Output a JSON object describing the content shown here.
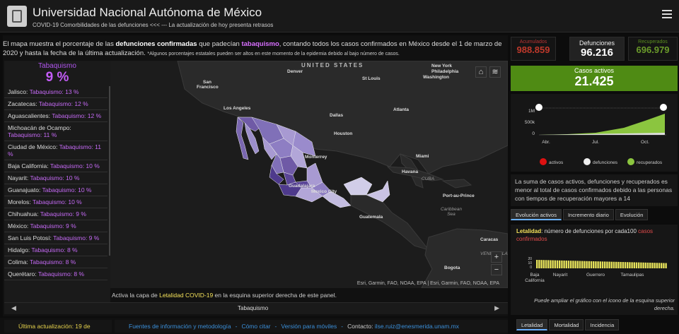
{
  "header": {
    "title": "Universidad Nacional Autónoma de México",
    "subtitle": "COVID-19 Comorbilidades de las defunciones <<< --- La actualización de hoy presenta retrasos"
  },
  "intro": {
    "p1": "El mapa muestra el porcentaje de las ",
    "b1": "defunciones confirmadas",
    "p2": " que padecían ",
    "hl": "tabaquismo",
    "p3": ", contando todos los casos confirmados en México desde el 1 de marzo de 2020 y hasta la fecha de la última actualización. ",
    "note": "*Algunos porcentajes estatales pueden ser altos en este momento de la epidemia debido al bajo número de casos."
  },
  "list": {
    "header_label": "Tabaquismo",
    "header_value": "9 %",
    "items": [
      {
        "state": "Jalisco:",
        "value": "Tabaquismo: 13 %"
      },
      {
        "state": "Zacatecas:",
        "value": "Tabaquismo: 12 %"
      },
      {
        "state": "Aguascalientes:",
        "value": "Tabaquismo: 12 %"
      },
      {
        "state": "Michoacán de Ocampo:",
        "value": "Tabaquismo: 11 %"
      },
      {
        "state": "Ciudad de México:",
        "value": "Tabaquismo: 11 %"
      },
      {
        "state": "Baja California:",
        "value": "Tabaquismo: 10 %"
      },
      {
        "state": "Nayarit:",
        "value": "Tabaquismo: 10 %"
      },
      {
        "state": "Guanajuato:",
        "value": "Tabaquismo: 10 %"
      },
      {
        "state": "Morelos:",
        "value": "Tabaquismo: 10 %"
      },
      {
        "state": "Chihuahua:",
        "value": "Tabaquismo: 9 %"
      },
      {
        "state": "México:",
        "value": "Tabaquismo: 9 %"
      },
      {
        "state": "San Luis Potosí:",
        "value": "Tabaquismo: 9 %"
      },
      {
        "state": "Hidalgo:",
        "value": "Tabaquismo: 8 %"
      },
      {
        "state": "Colima:",
        "value": "Tabaquismo: 8 %"
      },
      {
        "state": "Querétaro:",
        "value": "Tabaquismo: 8 %"
      }
    ]
  },
  "map": {
    "labels": {
      "united_states": "UNITED STATES",
      "new_york": "New York",
      "philadelphia": "Philadelphia",
      "washington": "Washington",
      "denver": "Denver",
      "st_louis": "St Louis",
      "san_francisco": "San Francisco",
      "los_angeles": "Los Angeles",
      "dallas": "Dallas",
      "atlanta": "Atlanta",
      "houston": "Houston",
      "miami": "Miami",
      "havana": "Havana",
      "cuba": "CUBA",
      "port_au_prince": "Port-au-Prince",
      "caribbean_sea": "Caribbean Sea",
      "monterrey": "Monterrey",
      "guadalajara": "Guadalajara",
      "mexico_city": "Mexico City",
      "guatemala": "Guatemala",
      "caracas": "Caracas",
      "bogota": "Bogota",
      "venezuela": "VENEZUELA"
    },
    "attribution": "Esri, Garmin, FAO, NOAA, EPA | Esri, Garmin, FAO, NOAA, EPA",
    "zoom_in": "+",
    "zoom_out": "−",
    "activa_prefix": "Activa la capa de ",
    "activa_hl": "Letalidad COVID-19",
    "activa_suffix": " en la esquina superior derecha de este panel.",
    "bottom_label": "Tabaquismo"
  },
  "footer": {
    "update": "Última actualización: 19 de",
    "link1": "Fuentes de información y metodología",
    "link2": "Cómo citar",
    "link3": "Versión para móviles",
    "contact_label": "Contacto: ",
    "contact_email": "ilse.ruiz@enesmerida.unam.mx"
  },
  "stats": {
    "acumulados_label": "Acumulados",
    "acumulados_value": "988.859",
    "defunciones_label": "Defunciones",
    "defunciones_value": "96.216",
    "recuperados_label": "Recuperados",
    "recuperados_value": "696.979",
    "activos_label": "Casos activos",
    "activos_value": "21.425"
  },
  "trend_chart": {
    "y_ticks": [
      "1M",
      "500k",
      "0"
    ],
    "x_ticks": [
      "Abr.",
      "Jul.",
      "Oct."
    ],
    "legend": [
      "activos",
      "defunciones",
      "recuperados"
    ]
  },
  "right_text": "La suma de casos activos, defunciones y recuperados es menor al total de casos confirmados debido a las personas con tiempos de recuperación mayores a 14",
  "tabs": [
    "Evolución activos",
    "Incremento diario",
    "Evolución"
  ],
  "letalidad": {
    "title_hl": "Letalidad",
    "title_mid": ": número de ",
    "title_word": "defunciones",
    "title_mid2": " por cada100 ",
    "title_red": "casos confirmados",
    "x_labels": [
      "Baja California",
      "Nayarit",
      "Guerrero",
      "Tamaulipas"
    ],
    "y_ticks": [
      "20",
      "10",
      "0"
    ],
    "note": "Puede ampliar el gráfico con el icono de la esquina superior derecha."
  },
  "bottom_tabs": [
    "Letalidad",
    "Mortalidad",
    "Incidencia"
  ],
  "colors": {
    "purple": "#c35cf7",
    "accent_green": "#4f8b14",
    "accent_red": "#e14b4b",
    "yellow": "#f5e25a"
  }
}
